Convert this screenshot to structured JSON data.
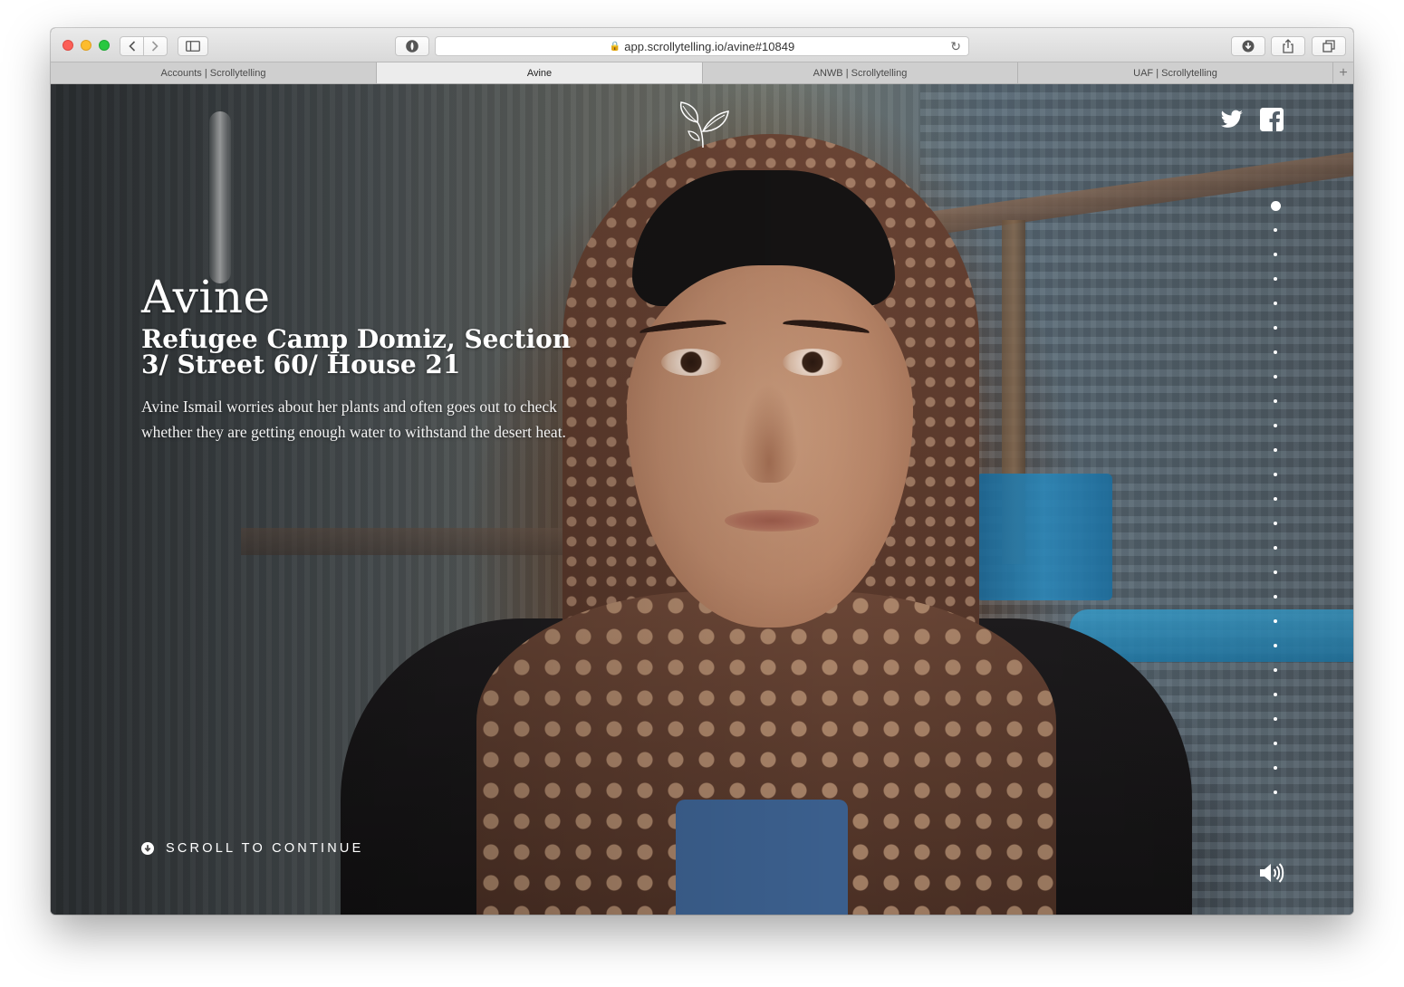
{
  "browser": {
    "url": "app.scrollytelling.io/avine#10849",
    "tabs": [
      {
        "label": "Accounts | Scrollytelling",
        "active": false
      },
      {
        "label": "Avine",
        "active": true
      },
      {
        "label": "ANWB | Scrollytelling",
        "active": false
      },
      {
        "label": "UAF | Scrollytelling",
        "active": false
      }
    ],
    "new_tab_label": "+"
  },
  "story": {
    "title": "Avine",
    "subtitle": "Refugee Camp Domiz, Section 3/ Street 60/ House 21",
    "description": "Avine Ismail worries about her plants and often goes out to check whether they are getting enough water to withstand the desert heat.",
    "scroll_label": "SCROLL TO CONTINUE"
  },
  "navigation": {
    "dot_count": 25,
    "active_index": 0
  },
  "icons": {
    "logo": "sprout-logo-icon",
    "share_twitter": "twitter-icon",
    "share_facebook": "facebook-icon",
    "scroll": "arrow-down-circle-icon",
    "audio": "speaker-icon"
  },
  "colors": {
    "overlay_text": "#ffffff",
    "active_tab": "#ececec",
    "tab_strip": "#cfcfcf"
  }
}
